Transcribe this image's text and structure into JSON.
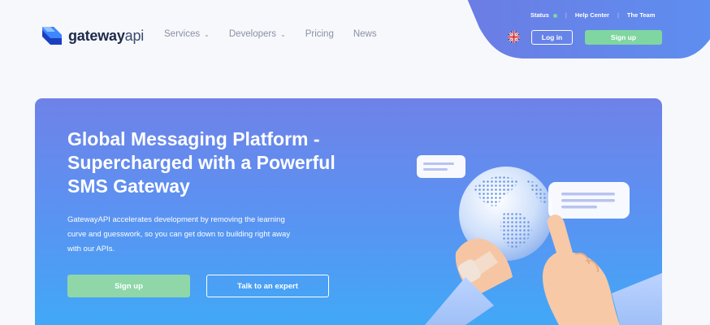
{
  "header": {
    "logo": {
      "bold": "gateway",
      "light": "api"
    },
    "nav": [
      {
        "label": "Services",
        "dropdown": true
      },
      {
        "label": "Developers",
        "dropdown": true
      },
      {
        "label": "Pricing",
        "dropdown": false
      },
      {
        "label": "News",
        "dropdown": false
      }
    ],
    "top_links": {
      "status": "Status",
      "help_center": "Help Center",
      "team": "The Team",
      "separator": "|"
    },
    "login_label": "Log in",
    "signup_label": "Sign up",
    "language_icon": "uk-flag-icon"
  },
  "hero": {
    "title_line1": "Global Messaging Platform -",
    "title_line2": "Supercharged with a Powerful",
    "title_line3": "SMS Gateway",
    "desc_line1": "GatewayAPI accelerates development by removing the learning",
    "desc_line2": "curve and guesswork, so you can get down to building right away",
    "desc_line3": "with our APIs.",
    "signup_label": "Sign up",
    "expert_label": "Talk to an expert"
  },
  "colors": {
    "hero_top": "#6f82e8",
    "hero_bottom": "#41a8f6",
    "accent_green": "#7fd6a0",
    "logo_blue": "#2f6df2",
    "background": "#f7f8fc"
  }
}
